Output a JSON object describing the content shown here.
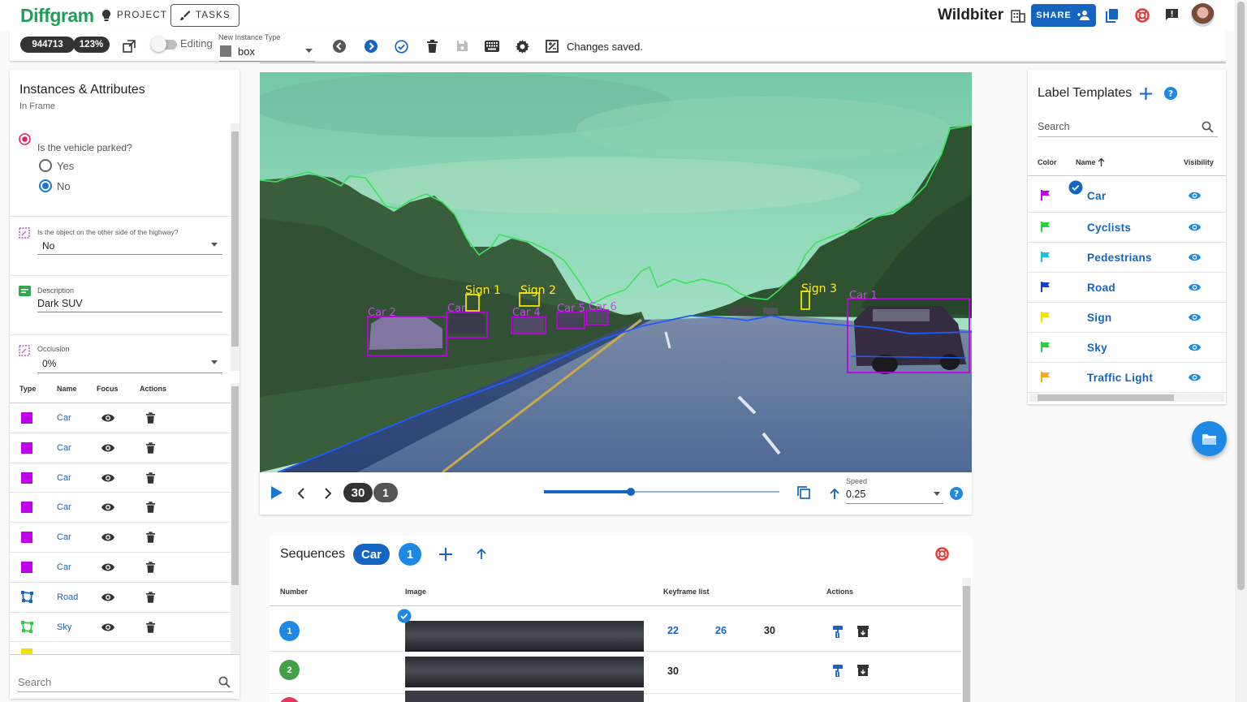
{
  "app": {
    "logo": "Diffgram",
    "project_btn": "PROJECT",
    "tasks_btn": "TASKS",
    "project_name": "Wildbiter",
    "share_btn": "SHARE"
  },
  "toolbar": {
    "file_id": "944713",
    "zoom": "123%",
    "editing_label": "Editing",
    "instance_type_label": "New Instance Type",
    "instance_type_value": "box",
    "status": "Changes saved."
  },
  "left": {
    "title": "Instances & Attributes",
    "subtitle": "In Frame",
    "q_parked": "Is the vehicle parked?",
    "opt_yes": "Yes",
    "opt_no": "No",
    "selected": "No",
    "q_highway": "Is the object on the other side of the highway?",
    "highway_value": "No",
    "desc_label": "Description",
    "desc_value": "Dark SUV",
    "occ_label": "Occlusion",
    "occ_value": "0%",
    "table_headers": {
      "type": "Type",
      "name": "Name",
      "focus": "Focus",
      "actions": "Actions"
    },
    "instances": [
      {
        "name": "Car",
        "kind": "box",
        "color": "#c000e8"
      },
      {
        "name": "Car",
        "kind": "box",
        "color": "#c000e8"
      },
      {
        "name": "Car",
        "kind": "box",
        "color": "#c000e8"
      },
      {
        "name": "Car",
        "kind": "box",
        "color": "#c000e8"
      },
      {
        "name": "Car",
        "kind": "box",
        "color": "#c000e8"
      },
      {
        "name": "Car",
        "kind": "box",
        "color": "#c000e8"
      },
      {
        "name": "Road",
        "kind": "polygon",
        "color": "#1565c0"
      },
      {
        "name": "Sky",
        "kind": "polygon",
        "color": "#2ecc40"
      }
    ],
    "search_placeholder": "Search"
  },
  "canvas": {
    "labels": {
      "sign1": "Sign 1",
      "sign2": "Sign 2",
      "sign3": "Sign 3",
      "car2": "Car 2",
      "car_a": "Car",
      "car4": "Car 4",
      "car5": "Car 5",
      "car6": "Car 6",
      "car1": "Car 1"
    }
  },
  "player": {
    "frame": "30",
    "count": "1",
    "speed_label": "Speed",
    "speed_value": "0.25",
    "progress": 0.37
  },
  "sequences": {
    "title": "Sequences",
    "label_chip": "Car",
    "count": "1",
    "headers": {
      "number": "Number",
      "image": "Image",
      "keyframes": "Keyframe list",
      "actions": "Actions"
    },
    "rows": [
      {
        "number": "1",
        "color": "#1e88e5",
        "keyframes": [
          "22",
          "26",
          "30"
        ]
      },
      {
        "number": "2",
        "color": "#43a047",
        "keyframes": [
          "30"
        ]
      }
    ]
  },
  "templates": {
    "title": "Label Templates",
    "search_placeholder": "Search",
    "headers": {
      "color": "Color",
      "name": "Name",
      "visibility": "Visibility"
    },
    "labels": [
      {
        "name": "Car",
        "color": "#c000e8"
      },
      {
        "name": "Cyclists",
        "color": "#2ecc40"
      },
      {
        "name": "Pedestrians",
        "color": "#22c1d6"
      },
      {
        "name": "Road",
        "color": "#1540c8"
      },
      {
        "name": "Sign",
        "color": "#f2e200"
      },
      {
        "name": "Sky",
        "color": "#2ecc40"
      },
      {
        "name": "Traffic Light",
        "color": "#f5a623"
      }
    ]
  }
}
